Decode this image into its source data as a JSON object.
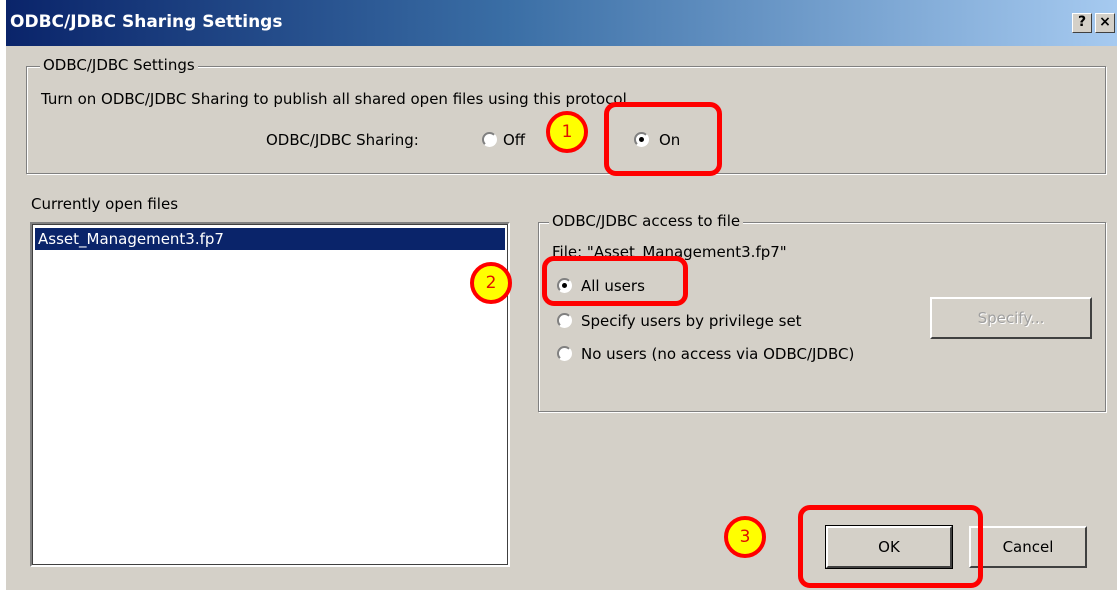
{
  "window": {
    "title": "ODBC/JDBC Sharing Settings",
    "help_label": "?",
    "close_label": "×"
  },
  "settings_group": {
    "legend": "ODBC/JDBC Settings",
    "description": "Turn on ODBC/JDBC Sharing to publish all shared open files using this protocol.",
    "sharing_label": "ODBC/JDBC Sharing:",
    "off_label": "Off",
    "on_label": "On",
    "selected": "On"
  },
  "open_files": {
    "label": "Currently open files",
    "items": [
      "Asset_Management3.fp7"
    ],
    "selected_index": 0
  },
  "access_group": {
    "legend": "ODBC/JDBC access to file",
    "file_line": "File: \"Asset_Management3.fp7\"",
    "options": [
      "All users",
      "Specify users by privilege set",
      "No users (no access via ODBC/JDBC)"
    ],
    "selected": "All users",
    "specify_label": "Specify..."
  },
  "buttons": {
    "ok_label": "OK",
    "cancel_label": "Cancel"
  },
  "callouts": [
    "1",
    "2",
    "3"
  ],
  "colors": {
    "annotation_red": "#ff0000",
    "badge_yellow": "#ffff00",
    "selection_blue": "#0a246a",
    "dialog_gray": "#d4d0c8"
  }
}
